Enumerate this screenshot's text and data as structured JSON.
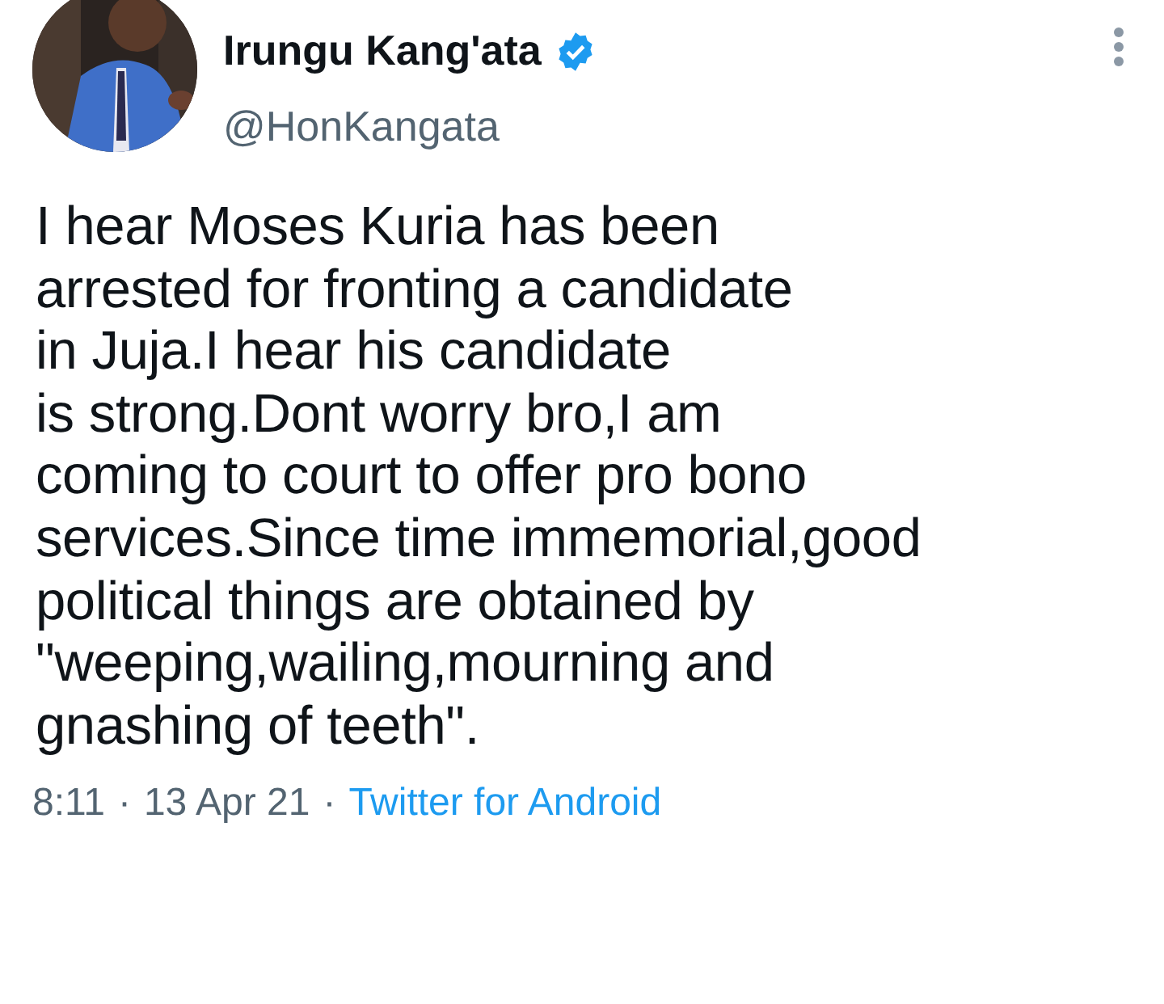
{
  "author": {
    "name": "Irungu Kang'ata",
    "verified": true,
    "handle": "@HonKangata"
  },
  "menu": {
    "kind": "more"
  },
  "text": "I hear Moses Kuria has been\narrested for fronting a candidate\nin Juja.I hear his candidate\nis strong.Dont worry bro,I am\ncoming to court to offer pro bono\nservices.Since time immemorial,good\npolitical things are obtained by\n\"weeping,wailing,mourning and\ngnashing of teeth\".",
  "meta": [
    {
      "kind": "time",
      "text": "8:11"
    },
    {
      "kind": "sep",
      "text": "·"
    },
    {
      "kind": "date",
      "text": "13 Apr 21"
    },
    {
      "kind": "sep",
      "text": "·"
    },
    {
      "kind": "source",
      "text": "Twitter for Android"
    }
  ]
}
